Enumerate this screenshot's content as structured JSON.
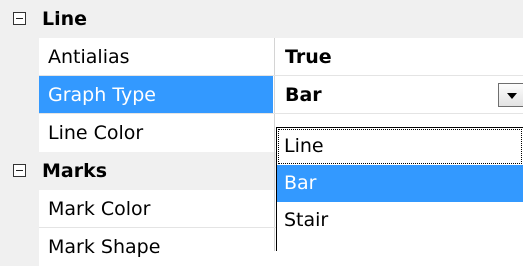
{
  "categories": {
    "line": {
      "label": "Line",
      "expander_symbol": "⊟"
    },
    "marks": {
      "label": "Marks",
      "expander_symbol": "⊟"
    }
  },
  "properties": {
    "antialias": {
      "name": "Antialias",
      "value": "True"
    },
    "graph_type": {
      "name": "Graph Type",
      "value": "Bar"
    },
    "line_color": {
      "name": "Line Color",
      "value": ""
    },
    "mark_color": {
      "name": "Mark Color",
      "value": ""
    },
    "mark_shape": {
      "name": "Mark Shape",
      "value": ""
    }
  },
  "dropdown": {
    "options": [
      "Line",
      "Bar",
      "Stair"
    ],
    "selected": "Bar"
  },
  "colors": {
    "selection": "#3399ff",
    "category_bg": "#f0f0f0"
  }
}
